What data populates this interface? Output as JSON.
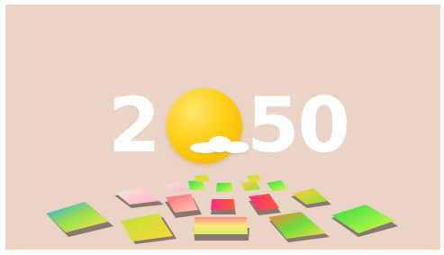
{
  "artwork": {
    "title_left": "2",
    "title_right": "50",
    "background_color": "#e9d4c6",
    "text_color": "#ffffff",
    "sun_color": "#ffcf14",
    "cloud_color": "#ffffff"
  }
}
